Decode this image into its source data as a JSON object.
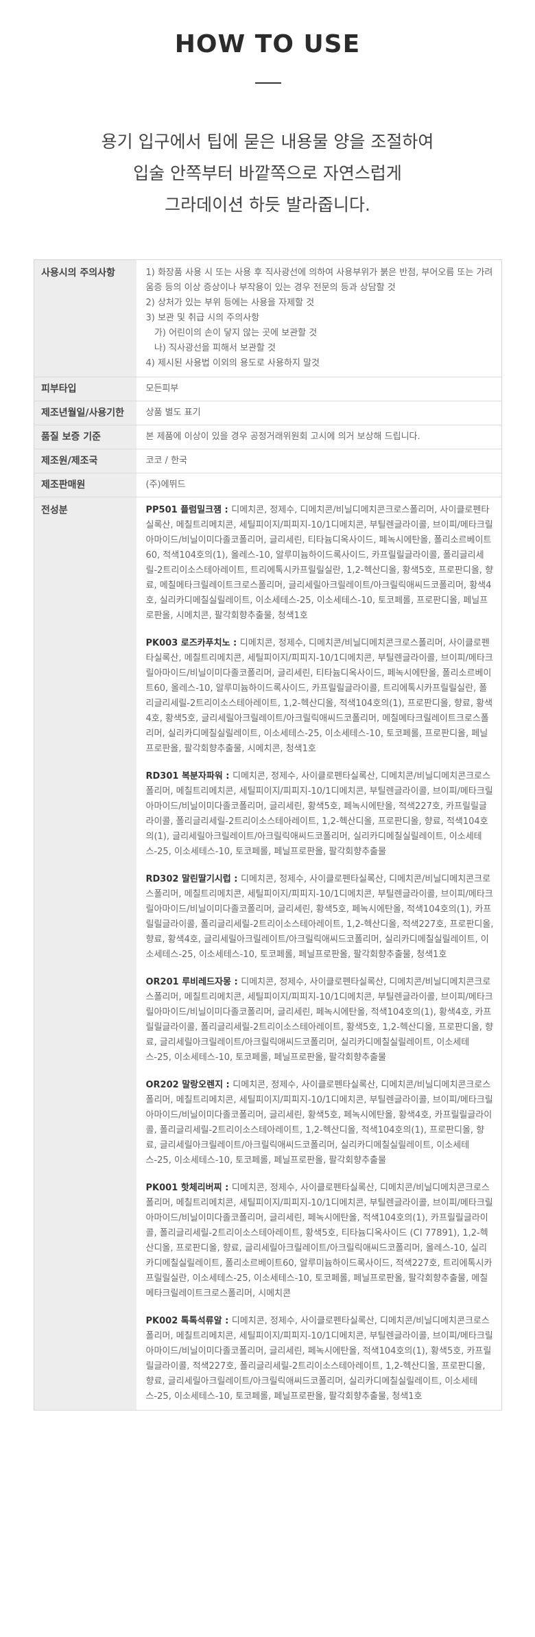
{
  "header": {
    "title": "HOW TO USE",
    "lead_lines": [
      "용기 입구에서 팁에 묻은 내용물 양을 조절하여",
      "입술 안쪽부터 바깥쪽으로 자연스럽게",
      "그라데이션 하듯 발라줍니다."
    ]
  },
  "info_table": {
    "precautions": {
      "label": "사용시의 주의사항",
      "lines": [
        "1) 화장품 사용 시 또는 사용 후 직사광선에 의하여 사용부위가 붉은 반점, 부어오름 또는 가려움증 등의 이상 증상이나 부작용이 있는 경우 전문의 등과 상담할 것",
        "2) 상처가 있는 부위 등에는 사용을 자제할 것",
        "3) 보관 및 취급 시의 주의사항",
        "   가) 어린이의 손이 닿지 않는 곳에 보관할 것",
        "   나) 직사광선을 피해서 보관할 것",
        "4) 제시된 사용법 이외의 용도로 사용하지 말것"
      ]
    },
    "skin_type": {
      "label": "피부타입",
      "value": "모든피부"
    },
    "mfg_date": {
      "label": "제조년월일/사용기한",
      "value": "상품 별도 표기"
    },
    "quality": {
      "label": "품질 보증 기준",
      "value": "본 제품에 이상이 있을 경우 공정거래위원회 고시에 의거 보상해 드립니다."
    },
    "origin": {
      "label": "제조원/제조국",
      "value": "코코 / 한국"
    },
    "seller": {
      "label": "제조판매원",
      "value": "(주)에뛰드"
    },
    "ingredients": {
      "label": "전성분",
      "items": [
        {
          "name": "PP501 플럼밀크잼 : ",
          "text": "디메치콘, 정제수, 디메치콘/비닐디메치콘크로스폴리머, 사이클로펜타실록산, 메칠트리메치콘, 세틸피이지/피피지-10/1디메치콘, 부틸렌글라이콜, 브이피/메타크릴아마이드/비닐이미다졸코폴리머, 글리세린, 티타늄디옥사이드, 페녹시에탄올, 폴리소르베이트60, 적색104호의(1), 올레스-10, 알루미늄하이드록사이드, 카프릴릴글라이콜, 폴리글리세릴-2트리이소스테아레이트, 트리에톡시카프릴릴실란, 1,2-헥산디올, 황색5호, 프로판디올, 향료, 메칠메타크릴레이트크로스폴리머, 글리세릴아크릴레이트/아크릴릭애씨드코폴리머, 황색4호, 실리카디메칠실릴레이트, 이소세테스-25, 이소세테스-10, 토코페롤, 프로판디올, 페닐프로판올, 시메치콘, 팔각회향추출물, 청색1호"
        },
        {
          "name": "PK003 로즈카푸치노 : ",
          "text": "디메치콘, 정제수, 디메치콘/비닐디메치콘크로스폴리머, 사이클로펜타실록산, 메칠트리메치콘, 세틸피이지/피피지-10/1디메치콘, 부틸렌글라이콜, 브이피/메타크릴아마이드/비닐이미다졸코폴리머, 글리세린, 티타늄디옥사이드, 페녹시에탄올, 폴리소르베이트60, 올레스-10, 알루미늄하이드록사이드, 카프릴릴글라이콜, 트리에톡시카프릴릴실란, 폴리글리세릴-2트리이소스테아레이트, 1,2-헥산디올, 적색104호의(1), 프로판디올, 향료, 황색4호, 황색5호, 글리세릴아크릴레이트/아크릴릭애씨드코폴리머, 메칠메타크릴레이트크로스폴리머, 실리카디메칠실릴레이트, 이소세테스-25, 이소세테스-10, 토코페롤, 프로판디올, 페닐프로판올, 팔각회향추출물, 시메치콘, 청색1호"
        },
        {
          "name": "RD301 복분자파워 : ",
          "text": "디메치콘, 정제수, 사이클로펜타실록산, 디메치콘/비닐디메치콘크로스폴리머, 메칠트리메치콘, 세틸피이지/피피지-10/1디메치콘, 부틸렌글라이콜, 브이피/메타크릴아마이드/비닐이미다졸코폴리머, 글리세린, 황색5호, 페녹시에탄올, 적색227호, 카프릴릴글라이콜, 폴리글리세릴-2트리이소스테아레이트, 1,2-헥산디올, 프로판디올, 향료, 적색104호의(1), 글리세릴아크릴레이트/아크릴릭애씨드코폴리머, 실리카디메칠실릴레이트, 이소세테스-25, 이소세테스-10, 토코페롤, 페닐프로판올, 팔각회향추출물"
        },
        {
          "name": "RD302 말린딸기시럽 : ",
          "text": "디메치콘, 정제수, 사이클로펜타실록산, 디메치콘/비닐디메치콘크로스폴리머, 메칠트리메치콘, 세틸피이지/피피지-10/1디메치콘, 부틸렌글라이콜, 브이피/메타크릴아마이드/비닐이미다졸코폴리머, 글리세린, 황색5호, 페녹시에탄올, 적색104호의(1), 카프릴릴글라이콜, 폴리글리세릴-2트리이소스테아레이트, 1,2-헥산디올, 적색227호, 프로판디올, 향료, 황색4호, 글리세릴아크릴레이트/아크릴릭애씨드코폴리머, 실리카디메칠실릴레이트, 이소세테스-25, 이소세테스-10, 토코페롤, 페닐프로판올, 팔각회향추출물, 청색1호"
        },
        {
          "name": "OR201 루비레드자몽 : ",
          "text": "디메치콘, 정제수, 사이클로펜타실록산, 디메치콘/비닐디메치콘크로스폴리머, 메칠트리메치콘, 세틸피이지/피피지-10/1디메치콘, 부틸렌글라이콜, 브이피/메타크릴아마이드/비닐이미다졸코폴리머, 글리세린, 페녹시에탄올, 적색104호의(1), 황색4호, 카프릴릴글라이콜, 폴리글리세릴-2트리이소스테아레이트, 황색5호, 1,2-헥산디올, 프로판디올, 향료, 글리세릴아크릴레이트/아크릴릭애씨드코폴리머, 실리카디메칠실릴레이트, 이소세테스-25, 이소세테스-10, 토코페롤, 페닐프로판올, 팔각회향추출물"
        },
        {
          "name": "OR202 말랑오렌지 : ",
          "text": "디메치콘, 정제수, 사이클로펜타실록산, 디메치콘/비닐디메치콘크로스폴리머, 메칠트리메치콘, 세틸피이지/피피지-10/1디메치콘, 부틸렌글라이콜, 브이피/메타크릴아마이드/비닐이미다졸코폴리머, 글리세린, 황색5호, 페녹시에탄올, 황색4호, 카프릴릴글라이콜, 폴리글리세릴-2트리이소스테아레이트, 1,2-헥산디올, 적색104호의(1), 프로판디올, 향료, 글리세릴아크릴레이트/아크릴릭애씨드코폴리머, 실리카디메칠실릴레이트, 이소세테스-25, 이소세테스-10, 토코페롤, 페닐프로판올, 팔각회향추출물"
        },
        {
          "name": "PK001 핫체리버찌 : ",
          "text": "디메치콘, 정제수, 사이클로펜타실록산, 디메치콘/비닐디메치콘크로스폴리머, 메칠트리메치콘, 세틸피이지/피피지-10/1디메치콘, 부틸렌글라이콜, 브이피/메타크릴아마이드/비닐이미다졸코폴리머, 글리세린, 페녹시에탄올, 적색104호의(1), 카프릴릴글라이콜, 폴리글리세릴-2트리이소스테아레이트, 황색5호, 티타늄디옥사이드 (CI 77891), 1,2-헥산디올, 프로판디올, 향료, 글리세릴아크릴레이트/아크릴릭애씨드코폴리머, 올레스-10, 실리카디메칠실릴레이트, 폴리소르베이트60, 알루미늄하이드록사이드, 적색227호, 트리에톡시카프릴릴실란, 이소세테스-25, 이소세테스-10, 토코페롤, 페닐프로판올, 팔각회향추출물, 메칠메타크릴레이트크로스폴리머, 시메치콘"
        },
        {
          "name": "PK002 톡톡석류알 : ",
          "text": "디메치콘, 정제수, 사이클로펜타실록산, 디메치콘/비닐디메치콘크로스폴리머, 메칠트리메치콘, 세틸피이지/피피지-10/1디메치콘, 부틸렌글라이콜, 브이피/메타크릴아마이드/비닐이미다졸코폴리머, 글리세린, 페녹시에탄올, 적색104호의(1), 황색5호, 카프릴릴글라이콜, 적색227호, 폴리글리세릴-2트리이소스테아레이트, 1,2-헥산디올, 프로판디올, 향료, 글리세릴아크릴레이트/아크릴릭애씨드코폴리머, 실리카디메칠실릴레이트, 이소세테스-25, 이소세테스-10, 토코페롤, 페닐프로판올, 팔각회향추출물, 청색1호"
        }
      ]
    }
  }
}
